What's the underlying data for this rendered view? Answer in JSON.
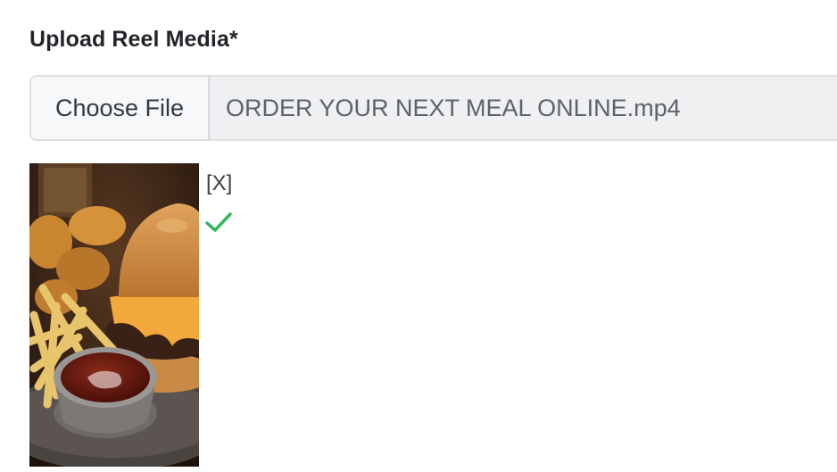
{
  "upload": {
    "label": "Upload Reel Media*",
    "choose_button": "Choose File",
    "file_name": "ORDER YOUR NEXT MEAL ONLINE.mp4",
    "remove_label": "[X]",
    "status_icon": "checkmark-icon",
    "status_color": "#2eb85c"
  }
}
